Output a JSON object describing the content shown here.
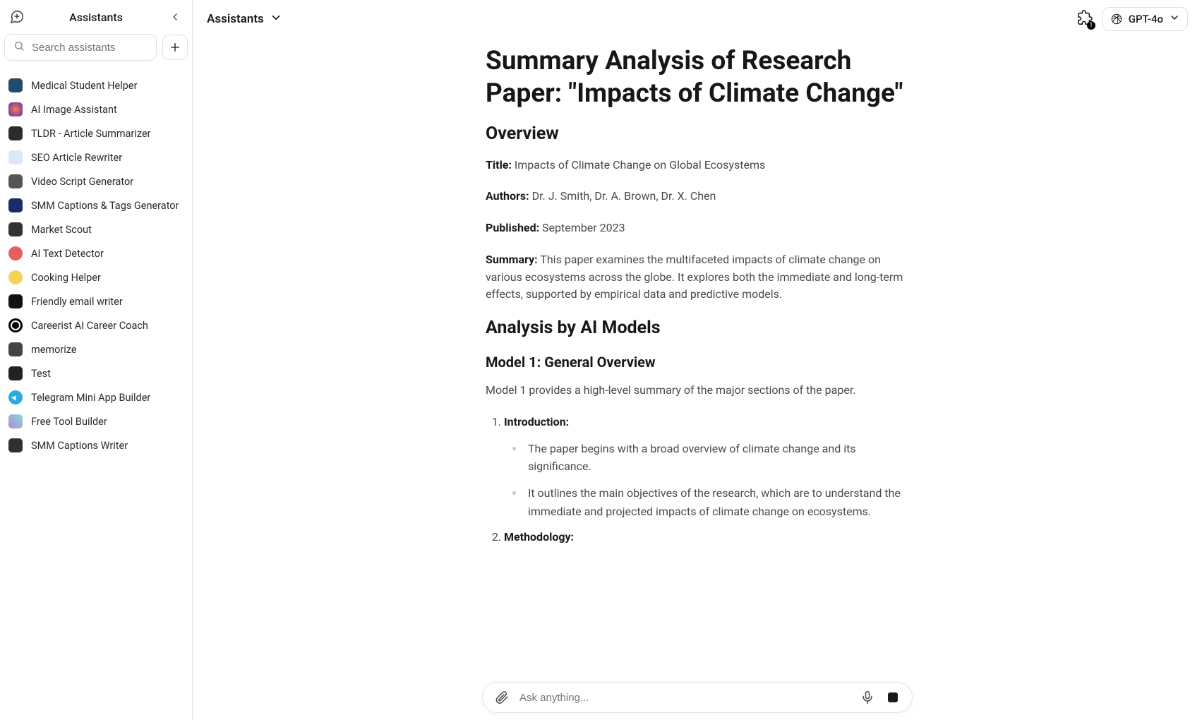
{
  "sidebar": {
    "title": "Assistants",
    "search_placeholder": "Search assistants",
    "items": [
      {
        "label": "Medical Student Helper"
      },
      {
        "label": "AI Image Assistant"
      },
      {
        "label": "TLDR - Article Summarizer"
      },
      {
        "label": "SEO Article Rewriter"
      },
      {
        "label": "Video Script Generator"
      },
      {
        "label": "SMM Captions & Tags Generator"
      },
      {
        "label": "Market Scout"
      },
      {
        "label": "AI Text Detector"
      },
      {
        "label": "Cooking Helper"
      },
      {
        "label": "Friendly email writer"
      },
      {
        "label": "Careerist AI Career Coach"
      },
      {
        "label": "memorize"
      },
      {
        "label": "Test"
      },
      {
        "label": "Telegram Mini App Builder"
      },
      {
        "label": "Free Tool Builder"
      },
      {
        "label": "SMM Captions Writer"
      }
    ]
  },
  "topbar": {
    "title": "Assistants",
    "extension_badge": "1",
    "model": "GPT-4o"
  },
  "doc": {
    "h1": "Summary Analysis of Research Paper: \"Impacts of Climate Change\"",
    "overview_h2": "Overview",
    "title_label": "Title:",
    "title_value": " Impacts of Climate Change on Global Ecosystems",
    "authors_label": "Authors:",
    "authors_value": " Dr. J. Smith, Dr. A. Brown, Dr. X. Chen",
    "published_label": "Published:",
    "published_value": " September 2023",
    "summary_label": "Summary:",
    "summary_value": " This paper examines the multifaceted impacts of climate change on various ecosystems across the globe. It explores both the immediate and long-term effects, supported by empirical data and predictive models.",
    "analysis_h2": "Analysis by AI Models",
    "model1_h3": "Model 1: General Overview",
    "model1_intro": "Model 1 provides a high-level summary of the major sections of the paper.",
    "ol": [
      {
        "title": "Introduction:",
        "bullets": [
          "The paper begins with a broad overview of climate change and its significance.",
          "It outlines the main objectives of the research, which are to understand the immediate and projected impacts of climate change on ecosystems."
        ]
      },
      {
        "title": "Methodology:",
        "bullets": []
      }
    ]
  },
  "input": {
    "placeholder": "Ask anything..."
  }
}
